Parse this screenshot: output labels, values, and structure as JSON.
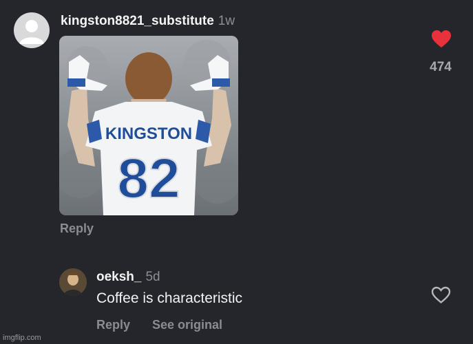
{
  "comment": {
    "username": "kingston8821_substitute",
    "age": "1w",
    "likes": "474",
    "reply_label": "Reply",
    "photo": {
      "jersey_name": "KINGSTON",
      "jersey_number": "82"
    }
  },
  "reply": {
    "username": "oeksh_",
    "age": "5d",
    "text": "Coffee is characteristic",
    "reply_label": "Reply",
    "see_original_label": "See original"
  },
  "watermark": "imgflip.com",
  "colors": {
    "background": "#25262b",
    "heart_filled": "#e8323b",
    "muted_text": "#8d8e93"
  }
}
